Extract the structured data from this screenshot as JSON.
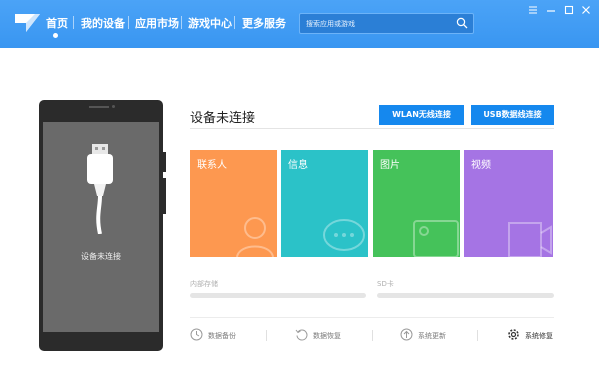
{
  "header": {
    "nav": [
      {
        "label": "首页",
        "active": true
      },
      {
        "label": "我的设备",
        "active": false
      },
      {
        "label": "应用市场",
        "active": false
      },
      {
        "label": "游戏中心",
        "active": false
      },
      {
        "label": "更多服务",
        "active": false
      }
    ],
    "search": {
      "placeholder": "搜索应用或游戏",
      "icon": "search-icon"
    },
    "window_controls": [
      "menu-icon",
      "minimize-icon",
      "maximize-icon",
      "close-icon"
    ],
    "colors": {
      "bar": "#3d9af3",
      "search_bg": "#2b7fd6"
    }
  },
  "phone": {
    "status": "设备未连接"
  },
  "device": {
    "title": "设备未连接",
    "buttons": {
      "wlan": "WLAN无线连接",
      "usb": "USB数据线连接"
    },
    "button_color": "#1588ee"
  },
  "tiles": [
    {
      "label": "联系人",
      "color": "#fd9850",
      "icon": "contact-icon"
    },
    {
      "label": "信息",
      "color": "#2bc2c8",
      "icon": "message-icon"
    },
    {
      "label": "图片",
      "color": "#45c25a",
      "icon": "picture-icon"
    },
    {
      "label": "视频",
      "color": "#a574e4",
      "icon": "video-icon"
    }
  ],
  "storage": [
    {
      "label": "内部存储",
      "used_fraction": 0
    },
    {
      "label": "SD卡",
      "used_fraction": 0
    }
  ],
  "tools": [
    {
      "label": "数据备份",
      "icon": "backup-icon",
      "emphasis": false
    },
    {
      "label": "数据恢复",
      "icon": "restore-icon",
      "emphasis": false
    },
    {
      "label": "系统更新",
      "icon": "update-icon",
      "emphasis": false
    },
    {
      "label": "系统修复",
      "icon": "settings-icon",
      "emphasis": true
    }
  ]
}
